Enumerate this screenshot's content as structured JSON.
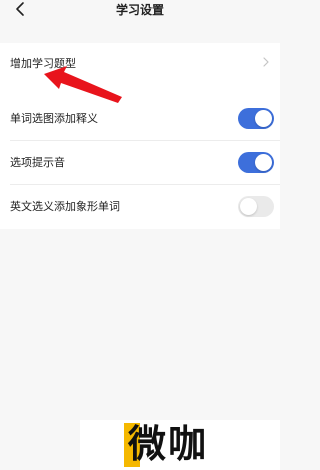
{
  "header": {
    "title": "学习设置",
    "back_icon": "chevron-left-icon"
  },
  "settings": {
    "add_question_type": {
      "label": "增加学习题型",
      "icon": "chevron-right-icon"
    },
    "word_image_definition": {
      "label": "单词选图添加释义",
      "enabled": true
    },
    "option_sound": {
      "label": "选项提示音",
      "enabled": true
    },
    "english_pictograph": {
      "label": "英文选义添加象形单词",
      "enabled": false
    }
  },
  "colors": {
    "toggle_on": "#3d6fdb",
    "toggle_off": "#eaeaea",
    "annotation_arrow": "#e8141c",
    "logo_accent": "#f5b800"
  },
  "watermark": {
    "text": "微咖"
  }
}
